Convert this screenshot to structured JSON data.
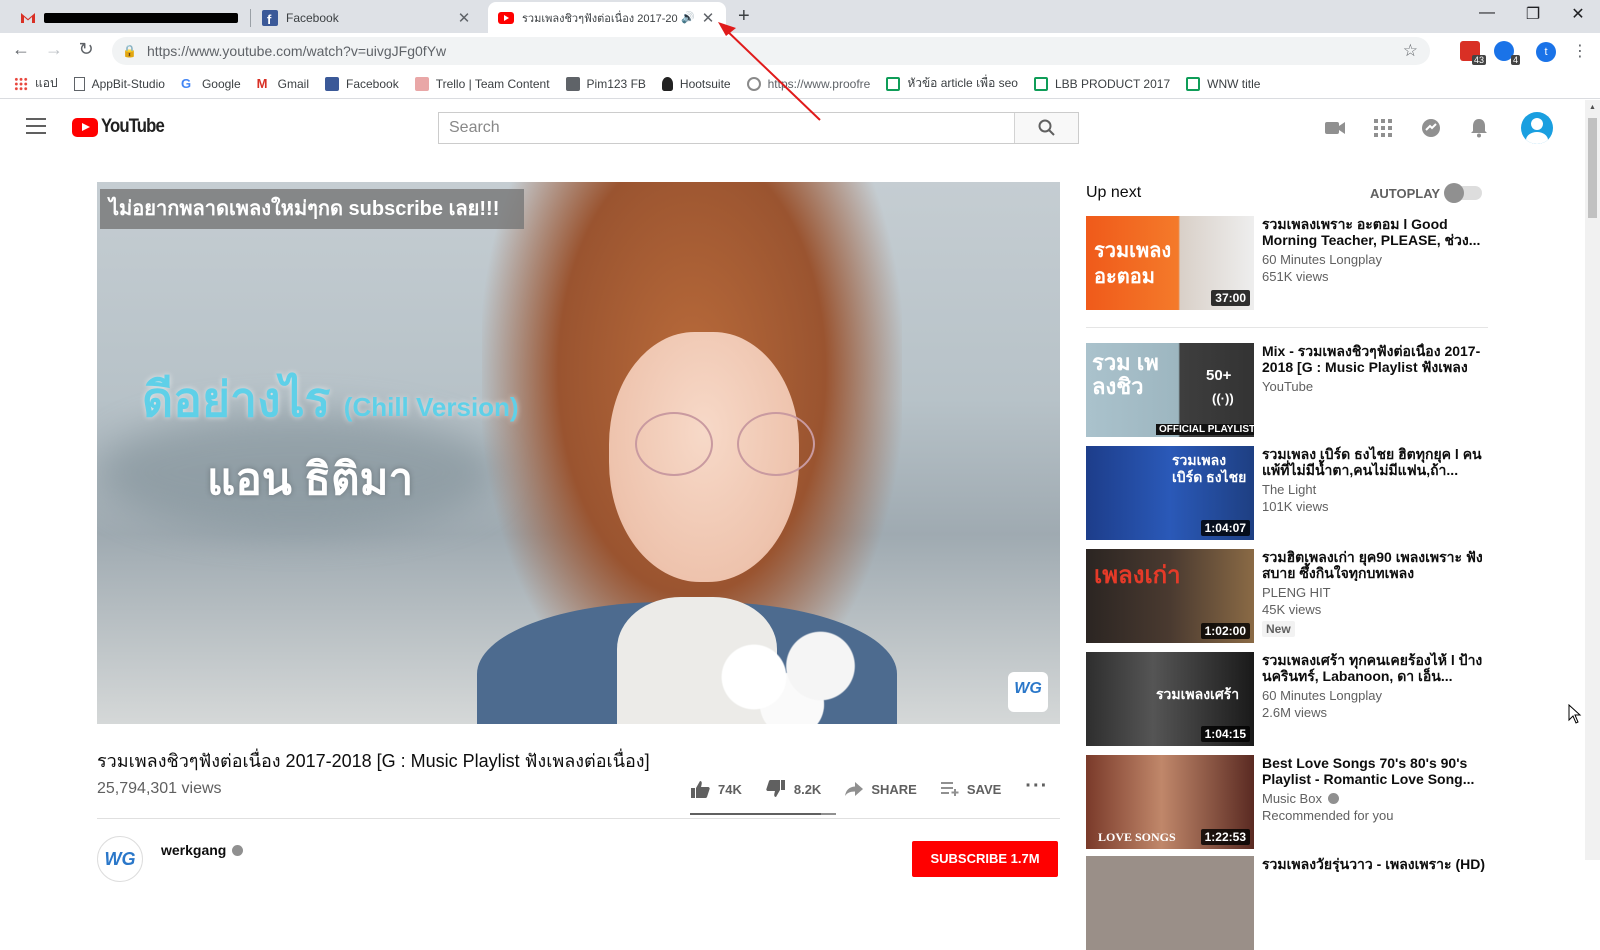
{
  "browser": {
    "tabs": [
      {
        "title": "",
        "favicon": "gmail-icon"
      },
      {
        "title": "Facebook",
        "favicon": "facebook-icon"
      },
      {
        "title": "รวมเพลงชิวๆฟังต่อเนื่อง 2017-20",
        "favicon": "youtube-icon",
        "audio": true
      }
    ],
    "url": "https://www.youtube.com/watch?v=uivgJFg0fYw",
    "extensions": [
      {
        "badge": "43"
      },
      {
        "badge": "4"
      }
    ],
    "profile_letter": "t",
    "bookmarks": [
      {
        "label": "แอป",
        "icon": "apps-grid-icon"
      },
      {
        "label": "AppBit-Studio",
        "icon": "page-icon"
      },
      {
        "label": "Google",
        "icon": "google-icon"
      },
      {
        "label": "Gmail",
        "icon": "gmail-icon"
      },
      {
        "label": "Facebook",
        "icon": "facebook-icon"
      },
      {
        "label": "Trello | Team Content",
        "icon": "trello-icon"
      },
      {
        "label": "Pim123 FB",
        "icon": "bookmark-icon"
      },
      {
        "label": "Hootsuite",
        "icon": "hootsuite-icon"
      },
      {
        "label": "https://www.proofre",
        "icon": "proofread-icon"
      },
      {
        "label": "หัวข้อ article เพื่อ seo",
        "icon": "sheets-icon"
      },
      {
        "label": "LBB PRODUCT 2017",
        "icon": "sheets-icon"
      },
      {
        "label": "WNW title",
        "icon": "sheets-icon"
      }
    ]
  },
  "youtube": {
    "logo_text": "YouTube",
    "search_placeholder": "Search",
    "player": {
      "banner": "ไม่อยากพลาดเพลงใหม่ๆกด subscribe เลย!!!",
      "song_title": "ดีอย่างไร",
      "song_version": "(Chill Version)",
      "artist": "แอน ธิติมา",
      "watermark": "WG"
    },
    "video": {
      "title": "รวมเพลงชิวๆฟังต่อเนื่อง 2017-2018 [G : Music Playlist ฟังเพลงต่อเนื่อง]",
      "views": "25,794,301 views",
      "likes": "74K",
      "dislikes": "8.2K",
      "share": "SHARE",
      "save": "SAVE",
      "like_ratio": 0.9
    },
    "channel": {
      "name": "werkgang",
      "subscribe": "SUBSCRIBE 1.7M"
    },
    "sidebar": {
      "up_next": "Up next",
      "autoplay": "AUTOPLAY",
      "autoplay_on": false,
      "items": [
        {
          "title": "รวมเพลงเพราะ อะตอม l Good Morning Teacher, PLEASE, ช่วง...",
          "channel": "60 Minutes Longplay",
          "views": "651K views",
          "duration": "37:00",
          "thumb_text": "รวมเพลง อะตอม"
        },
        {
          "title": "Mix - รวมเพลงชิวๆฟังต่อเนื่อง 2017-2018 [G : Music Playlist ฟังเพลงต่อ...",
          "channel": "YouTube",
          "views": "",
          "duration": "",
          "thumb_text": "รวม เพลงชิว",
          "mix_count": "50+",
          "playlist_label": "OFFICIAL PLAYLIST"
        },
        {
          "title": "รวมเพลง เบิร์ด ธงไชย ฮิตทุกยุค l คนแพ้ที่ไม่มีน้ำตา,คนไม่มีแฟน,ถ้า...",
          "channel": "The Light",
          "views": "101K views",
          "duration": "1:04:07",
          "thumb_text": "รวมเพลง เบิร์ด ธงไชย"
        },
        {
          "title": "รวมฮิตเพลงเก่า ยุค90 เพลงเพราะ ฟังสบาย ซึ้งกินใจทุกบทเพลง",
          "channel": "PLENG HIT",
          "views": "45K views",
          "duration": "1:02:00",
          "thumb_text": "เพลงเก่า",
          "badge": "New"
        },
        {
          "title": "รวมเพลงเศร้า ทุกคนเคยร้องไห้ l ป้าง นครินทร์, Labanoon, ดา เอ็น...",
          "channel": "60 Minutes Longplay",
          "views": "2.6M views",
          "duration": "1:04:15",
          "thumb_text": "รวมเพลงเศร้า"
        },
        {
          "title": "Best Love Songs 70's 80's 90's Playlist - Romantic Love Song...",
          "channel": "Music Box",
          "views": "Recommended for you",
          "duration": "1:22:53",
          "thumb_text": "LOVE SONGS"
        },
        {
          "title": "รวมเพลงวัยรุ่นวาว - เพลงเพราะ (HD)",
          "channel": "",
          "views": "",
          "duration": "",
          "thumb_text": ""
        }
      ]
    }
  },
  "colors": {
    "brand_red": "#ff0000",
    "tabstrip": "#dee1e6",
    "link_blue": "#1a73e8"
  }
}
